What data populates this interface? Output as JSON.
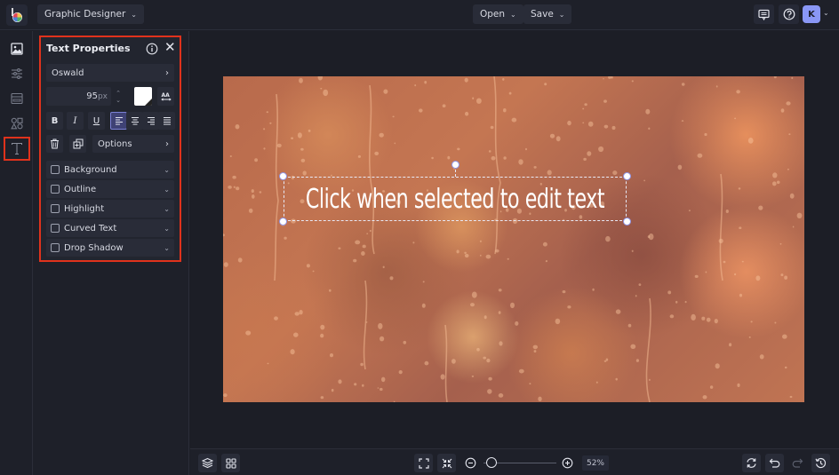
{
  "app": {
    "menu_label": "Graphic Designer",
    "open_label": "Open",
    "save_label": "Save",
    "user_initial": "K",
    "accent_color": "#8a97f5",
    "highlight_color": "#e0321c"
  },
  "rail": {
    "items": [
      {
        "name": "image",
        "icon": "image-icon"
      },
      {
        "name": "adjust",
        "icon": "sliders-icon"
      },
      {
        "name": "layout",
        "icon": "layout-icon"
      },
      {
        "name": "graphics",
        "icon": "shapes-icon"
      },
      {
        "name": "text",
        "icon": "text-icon",
        "active": true
      }
    ]
  },
  "panel": {
    "title": "Text Properties",
    "font": "Oswald",
    "font_size": "95",
    "font_size_unit": "px",
    "text_color": "#ffffff",
    "format_buttons": {
      "bold": "B",
      "italic": "I",
      "underline": "U"
    },
    "alignment": "left",
    "options_label": "Options",
    "toggles": [
      {
        "label": "Background",
        "checked": false
      },
      {
        "label": "Outline",
        "checked": false
      },
      {
        "label": "Highlight",
        "checked": false
      },
      {
        "label": "Curved Text",
        "checked": false
      },
      {
        "label": "Drop Shadow",
        "checked": false
      }
    ]
  },
  "canvas": {
    "text": "Click when selected to edit text"
  },
  "bottom": {
    "zoom_percent": "52%",
    "zoom_level": 0.52
  }
}
